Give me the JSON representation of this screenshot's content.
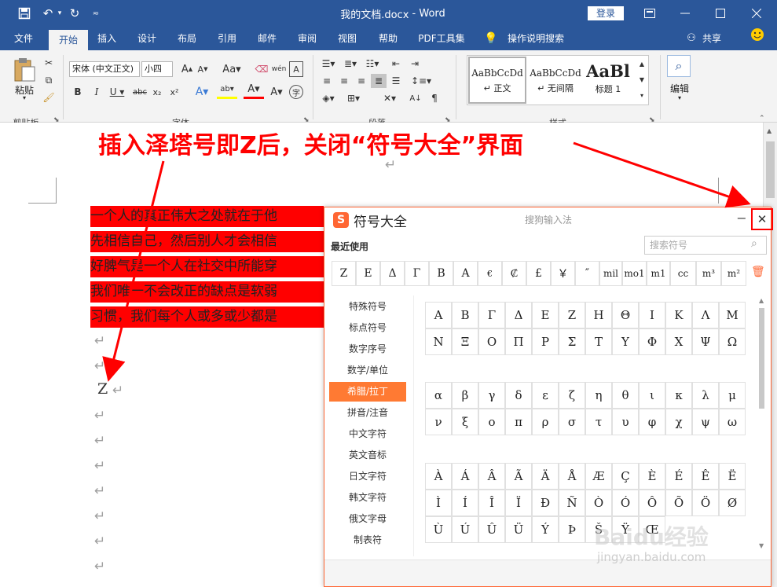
{
  "titlebar": {
    "title": "我的文档.docx",
    "sep": "-",
    "app": "Word",
    "login": "登录"
  },
  "tabs": [
    "文件",
    "开始",
    "插入",
    "设计",
    "布局",
    "引用",
    "邮件",
    "审阅",
    "视图",
    "帮助",
    "PDF工具集",
    "操作说明搜索",
    "共享"
  ],
  "ribbon": {
    "paste": "粘贴",
    "clipboard": "剪贴板",
    "font_name": "宋体 (中文正文)",
    "font_size": "小四",
    "font_group": "字体",
    "para_group": "段落",
    "styles": [
      {
        "preview": "AaBbCcDd",
        "name": "↵ 正文"
      },
      {
        "preview": "AaBbCcDd",
        "name": "↵ 无间隔"
      },
      {
        "preview": "AaBl",
        "name": "标题 1"
      }
    ],
    "styles_group": "样式",
    "edit": "编辑"
  },
  "annotation": "插入泽塔号即Z后，关闭“符号大全”界面",
  "document": {
    "highlight_lines": [
      "一个人的真正伟大之处就在于他",
      "先相信自己，然后别人才会相信",
      "好脾气是一个人在社交中所能穿",
      "我们唯一不会改正的缺点是软弱",
      "习惯，我们每个人或多或少都是"
    ],
    "inserted": "Z",
    "para_mark": "↵"
  },
  "symbol_panel": {
    "logo": "S",
    "title": "符号大全",
    "subtitle": "搜狗输入法",
    "minimize": "−",
    "close": "✕",
    "recent_label": "最近使用",
    "search_placeholder": "搜索符号",
    "recent": [
      "Z",
      "Ε",
      "Δ",
      "Γ",
      "Β",
      "A",
      "€",
      "₡",
      "£",
      "￥",
      "″",
      "mil",
      "mo1",
      "m1",
      "cc",
      "m³",
      "m²"
    ],
    "categories": [
      "特殊符号",
      "标点符号",
      "数字序号",
      "数学/单位",
      "希腊/拉丁",
      "拼音/注音",
      "中文字符",
      "英文音标",
      "日文字符",
      "韩文字符",
      "俄文字母",
      "制表符"
    ],
    "active_category": "希腊/拉丁",
    "greek_upper": [
      "Α",
      "Β",
      "Γ",
      "Δ",
      "Ε",
      "Ζ",
      "Η",
      "Θ",
      "Ι",
      "Κ",
      "Λ",
      "Μ",
      "Ν",
      "Ξ",
      "Ο",
      "Π",
      "Ρ",
      "Σ",
      "Τ",
      "Υ",
      "Φ",
      "Χ",
      "Ψ",
      "Ω"
    ],
    "greek_lower": [
      "α",
      "β",
      "γ",
      "δ",
      "ε",
      "ζ",
      "η",
      "θ",
      "ι",
      "κ",
      "λ",
      "μ",
      "ν",
      "ξ",
      "ο",
      "π",
      "ρ",
      "σ",
      "τ",
      "υ",
      "φ",
      "χ",
      "ψ",
      "ω"
    ],
    "latin": [
      "À",
      "Á",
      "Â",
      "Ã",
      "Ä",
      "Å",
      "Æ",
      "Ç",
      "È",
      "É",
      "Ê",
      "Ë",
      "Ì",
      "Í",
      "Î",
      "Ï",
      "Ð",
      "Ñ",
      "Ò",
      "Ó",
      "Ô",
      "Õ",
      "Ö",
      "Ø",
      "Ù",
      "Ú",
      "Û",
      "Ü",
      "Ý",
      "Þ",
      "Š",
      "Ÿ",
      "Œ"
    ]
  },
  "watermark": {
    "brand": "Baidu经验",
    "url": "jingyan.baidu.com"
  },
  "colors": {
    "word_blue": "#2b579a",
    "highlight": "#ff0000",
    "sogou_orange": "#ff6633",
    "annotation_red": "#ff0000"
  }
}
